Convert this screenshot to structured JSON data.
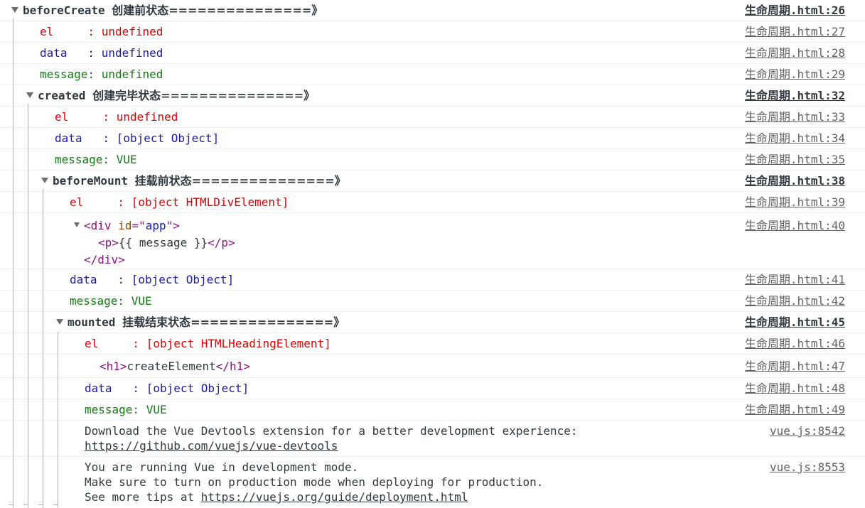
{
  "groups": {
    "beforeCreate": {
      "title": "beforeCreate",
      "title_zh": "创建前状态===============》",
      "source": "生命周期.html:26",
      "rows": [
        {
          "label": "el     : ",
          "value": "undefined",
          "source": "生命周期.html:27"
        },
        {
          "label": "data   : ",
          "value": "undefined",
          "source": "生命周期.html:28"
        },
        {
          "label": "message: ",
          "value": "undefined",
          "source": "生命周期.html:29"
        }
      ]
    },
    "created": {
      "title": "created",
      "title_zh": "创建完毕状态===============》",
      "source": "生命周期.html:32",
      "rows": [
        {
          "label": "el     : ",
          "value": "undefined",
          "source": "生命周期.html:33"
        },
        {
          "label": "data   : ",
          "value": "[object Object]",
          "source": "生命周期.html:34"
        },
        {
          "label": "message: ",
          "value": "VUE",
          "source": "生命周期.html:35"
        }
      ]
    },
    "beforeMount": {
      "title": "beforeMount",
      "title_zh": "挂载前状态===============》",
      "source": "生命周期.html:38",
      "el_row": {
        "label": "el     : ",
        "value": "[object HTMLDivElement]",
        "source": "生命周期.html:39"
      },
      "dom_row": {
        "source": "生命周期.html:40",
        "open_tag": "div",
        "attr_name": "id",
        "attr_value": "app",
        "child_tag": "p",
        "child_text": "{{ message }}",
        "close_tag": "div"
      },
      "rows": [
        {
          "label": "data   : ",
          "value": "[object Object]",
          "source": "生命周期.html:41"
        },
        {
          "label": "message: ",
          "value": "VUE",
          "source": "生命周期.html:42"
        }
      ]
    },
    "mounted": {
      "title": "mounted",
      "title_zh": "挂载结束状态===============》",
      "source": "生命周期.html:45",
      "el_row": {
        "label": "el     : ",
        "value": "[object HTMLHeadingElement]",
        "source": "生命周期.html:46"
      },
      "dom_row": {
        "source": "生命周期.html:47",
        "tag": "h1",
        "text": "createElement"
      },
      "rows": [
        {
          "label": "data   : ",
          "value": "[object Object]",
          "source": "生命周期.html:48"
        },
        {
          "label": "message: ",
          "value": "VUE",
          "source": "生命周期.html:49"
        }
      ]
    }
  },
  "devtools_msg": {
    "line1": "Download the Vue Devtools extension for a better development experience:",
    "link": "https://github.com/vuejs/vue-devtools",
    "source": "vue.js:8542"
  },
  "devmode_msg": {
    "line1": "You are running Vue in development mode.",
    "line2": "Make sure to turn on production mode when deploying for production.",
    "line3_prefix": "See more tips at ",
    "link": "https://vuejs.org/guide/deployment.html",
    "source": "vue.js:8553"
  },
  "colors": {
    "el": "#e00000",
    "data": "#1a1aa6",
    "message": "#0f7d0f",
    "tag": "#881280",
    "attr": "#994500"
  },
  "icons": {
    "expand": "triangle-down-icon"
  }
}
